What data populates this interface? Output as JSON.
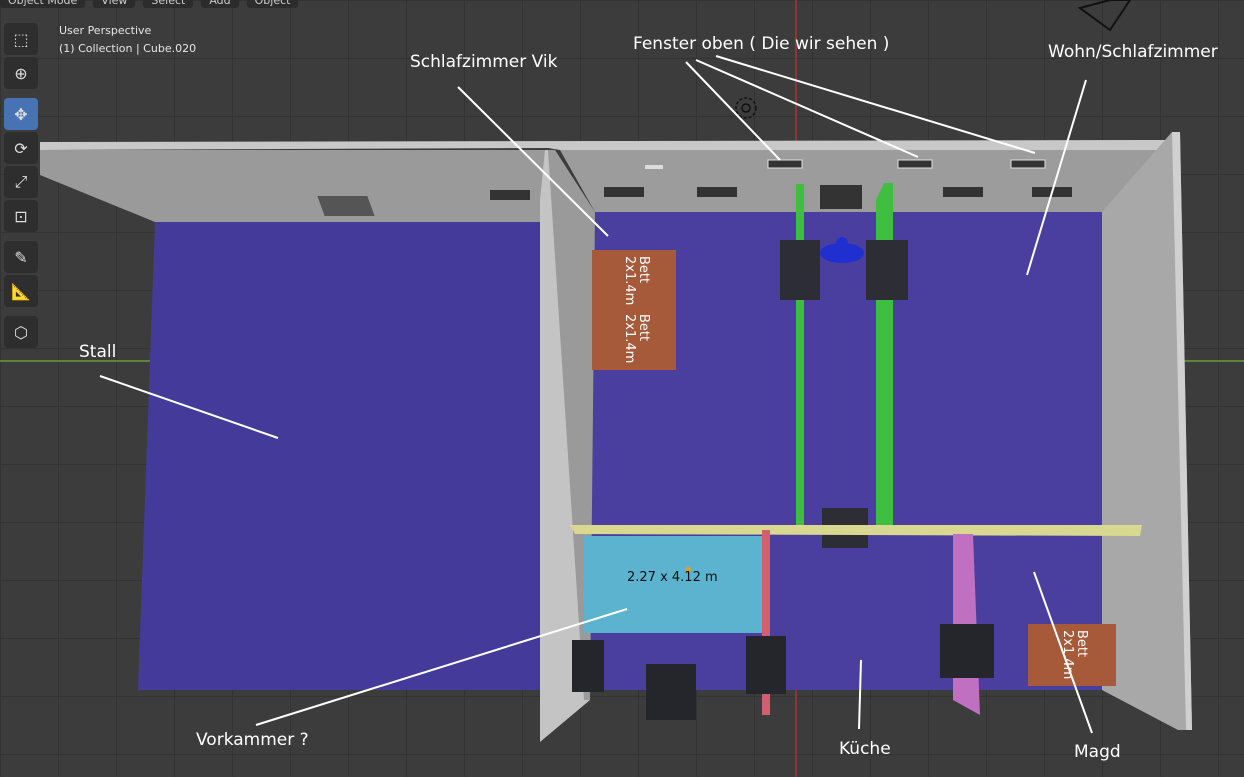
{
  "header": {
    "menu": [
      "Object Mode",
      "View",
      "Select",
      "Add",
      "Object"
    ]
  },
  "viewport_info": {
    "perspective": "User Perspective",
    "collection": "(1) Collection | Cube.020"
  },
  "tools": [
    {
      "name": "select-tool",
      "icon": "cursor-select-icon"
    },
    {
      "name": "cursor-tool",
      "icon": "3d-cursor-icon"
    },
    {
      "name": "move-tool",
      "icon": "move-arrows-icon",
      "active": true
    },
    {
      "name": "rotate-tool",
      "icon": "rotate-icon"
    },
    {
      "name": "scale-tool",
      "icon": "scale-icon"
    },
    {
      "name": "transform-tool",
      "icon": "transform-icon"
    },
    {
      "name": "annotate-tool",
      "icon": "annotate-pen-icon"
    },
    {
      "name": "measure-tool",
      "icon": "measure-ruler-icon"
    },
    {
      "name": "add-cube-tool",
      "icon": "add-cube-icon"
    }
  ],
  "annotations": {
    "schlafzimmer_vik": "Schlafzimmer Vik",
    "fenster": "Fenster oben ( Die wir sehen )",
    "wohn": "Wohn/Schlafzimmer",
    "stall": "Stall",
    "vorkammer": "Vorkammer ?",
    "kueche": "Küche",
    "magd": "Magd"
  },
  "beds": {
    "bed1": [
      "Bett",
      "2x1.4m"
    ],
    "bed2": [
      "Bett",
      "2x1.4m"
    ],
    "bed3": [
      "Bett",
      "2x1.4m"
    ]
  },
  "measurement": "2.27 x 4.12 m",
  "colors": {
    "floor": "#443a9a",
    "wall": "#b8b8b8",
    "bed": "#a65a3a",
    "vorkammer": "#5bb3d0",
    "divider_yellow": "#d8d890",
    "divider_green": "#3fbf3f",
    "divider_red": "#d06070",
    "divider_pink": "#c070c0",
    "axis_x": "#a0383a",
    "axis_y": "#6a9b3a"
  }
}
